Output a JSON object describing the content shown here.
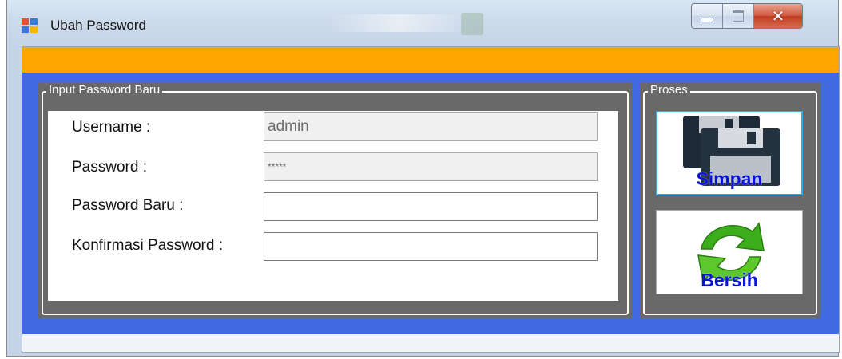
{
  "window": {
    "title": "Ubah Password",
    "icon": "app-window-icon",
    "controls": {
      "minimize": "minimize-icon",
      "maximize": "maximize-icon",
      "close": "close-icon"
    }
  },
  "colors": {
    "header_bar": "#ffa500",
    "form_background": "#4169e1",
    "group_background": "#696969",
    "button_text": "#0a14d8"
  },
  "input_group": {
    "legend": "Input Password Baru",
    "fields": {
      "username": {
        "label": "Username :",
        "value": "admin"
      },
      "password": {
        "label": "Password :",
        "value": "*****"
      },
      "new_password": {
        "label": "Password Baru :",
        "value": ""
      },
      "confirm_password": {
        "label": "Konfirmasi Password :",
        "value": ""
      }
    }
  },
  "process_group": {
    "legend": "Proses",
    "save_button": {
      "label": "Simpan",
      "icon": "floppy-disk-icon"
    },
    "clear_button": {
      "label": "Bersih",
      "icon": "refresh-arrows-icon"
    }
  }
}
